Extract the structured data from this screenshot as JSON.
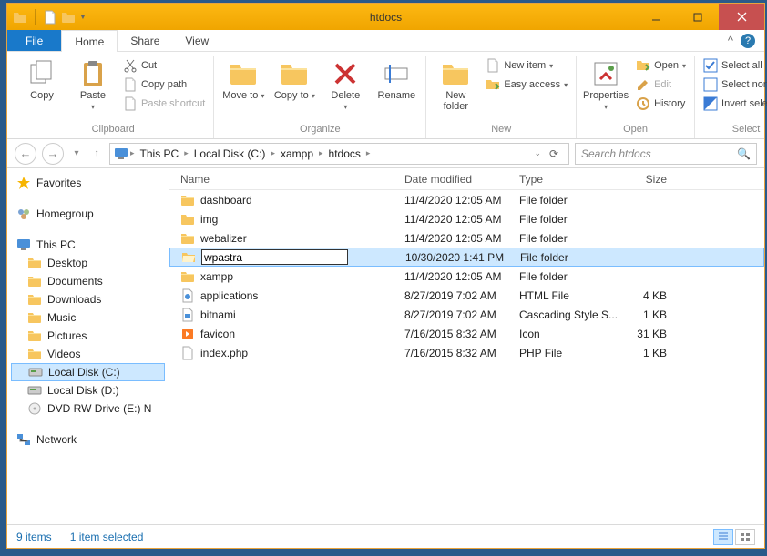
{
  "window": {
    "title": "htdocs"
  },
  "menubar": {
    "file": "File",
    "home": "Home",
    "share": "Share",
    "view": "View"
  },
  "ribbon": {
    "clipboard": {
      "label": "Clipboard",
      "copy": "Copy",
      "paste": "Paste",
      "cut": "Cut",
      "copypath": "Copy path",
      "pasteshortcut": "Paste shortcut"
    },
    "organize": {
      "label": "Organize",
      "moveto": "Move to",
      "copyto": "Copy to",
      "delete": "Delete",
      "rename": "Rename"
    },
    "new": {
      "label": "New",
      "newfolder": "New folder",
      "newitem": "New item",
      "easyaccess": "Easy access"
    },
    "open": {
      "label": "Open",
      "properties": "Properties",
      "open": "Open",
      "edit": "Edit",
      "history": "History"
    },
    "select": {
      "label": "Select",
      "selectall": "Select all",
      "selectnone": "Select none",
      "invert": "Invert selection"
    }
  },
  "breadcrumbs": [
    "This PC",
    "Local Disk (C:)",
    "xampp",
    "htdocs"
  ],
  "search": {
    "placeholder": "Search htdocs"
  },
  "nav": {
    "favorites": "Favorites",
    "homegroup": "Homegroup",
    "thispc": {
      "label": "This PC",
      "items": [
        "Desktop",
        "Documents",
        "Downloads",
        "Music",
        "Pictures",
        "Videos",
        "Local Disk (C:)",
        "Local Disk (D:)",
        "DVD RW Drive (E:) N"
      ]
    },
    "network": "Network"
  },
  "columns": {
    "name": "Name",
    "date": "Date modified",
    "type": "Type",
    "size": "Size"
  },
  "files": [
    {
      "name": "dashboard",
      "date": "11/4/2020 12:05 AM",
      "type": "File folder",
      "size": "",
      "icon": "folder"
    },
    {
      "name": "img",
      "date": "11/4/2020 12:05 AM",
      "type": "File folder",
      "size": "",
      "icon": "folder"
    },
    {
      "name": "webalizer",
      "date": "11/4/2020 12:05 AM",
      "type": "File folder",
      "size": "",
      "icon": "folder"
    },
    {
      "name": "wpastra",
      "date": "10/30/2020 1:41 PM",
      "type": "File folder",
      "size": "",
      "icon": "folder-open",
      "selected": true,
      "editing": true
    },
    {
      "name": "xampp",
      "date": "11/4/2020 12:05 AM",
      "type": "File folder",
      "size": "",
      "icon": "folder"
    },
    {
      "name": "applications",
      "date": "8/27/2019 7:02 AM",
      "type": "HTML File",
      "size": "4 KB",
      "icon": "html"
    },
    {
      "name": "bitnami",
      "date": "8/27/2019 7:02 AM",
      "type": "Cascading Style S...",
      "size": "1 KB",
      "icon": "css"
    },
    {
      "name": "favicon",
      "date": "7/16/2015 8:32 AM",
      "type": "Icon",
      "size": "31 KB",
      "icon": "favicon"
    },
    {
      "name": "index.php",
      "date": "7/16/2015 8:32 AM",
      "type": "PHP File",
      "size": "1 KB",
      "icon": "file"
    }
  ],
  "status": {
    "items": "9 items",
    "selected": "1 item selected"
  }
}
